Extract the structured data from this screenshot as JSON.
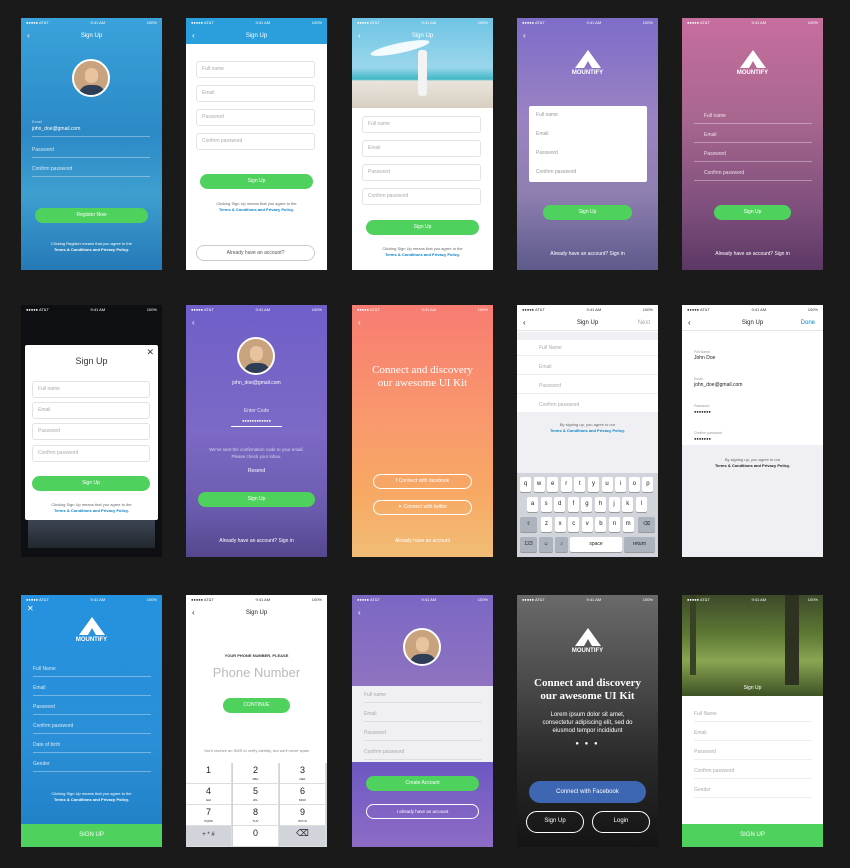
{
  "status": {
    "carrier": "●●●●● AT&T",
    "time": "9:41 AM",
    "battery": "100%"
  },
  "colors": {
    "blue": "#2b9fdc",
    "green": "#4fd15d",
    "purple": "#6f5fc9",
    "pink": "#c76e9e",
    "orange": "#f78b6d"
  },
  "s1": {
    "title": "Sign Up",
    "email_label": "Email",
    "email": "john_doe@gmail.com",
    "password": "Password",
    "confirm": "Confirm password",
    "button": "Register Now",
    "terms1": "Clicking Register means that you agree to the",
    "terms2": "Terms & Conditions and Privacy Policy."
  },
  "s2": {
    "title": "Sign Up",
    "fields": [
      "Full name",
      "Email",
      "Password",
      "Confirm password"
    ],
    "button": "Sign Up",
    "terms1": "Clicking Sign Up means that you agree to the",
    "terms2": "Terms & Conditions and Privacy Policy.",
    "have_account": "Already have an account?"
  },
  "s3": {
    "title": "Sign Up",
    "fields": [
      "Full name",
      "Email",
      "Password",
      "Confirm password"
    ],
    "button": "Sign Up",
    "terms1": "Clicking Sign Up means that you agree to the",
    "terms2": "Terms & Conditions and Privacy Policy."
  },
  "s4": {
    "brand": "MOUNTIFY",
    "fields": [
      "Full name",
      "Email",
      "Password",
      "Confirm password"
    ],
    "button": "Sign Up",
    "have_account": "Already have an account? Sign in"
  },
  "s5": {
    "brand": "MOUNTIFY",
    "fields": [
      "Full name",
      "Email",
      "Password",
      "Confirm password"
    ],
    "button": "Sign Up",
    "have_account": "Already have an account? Sign in"
  },
  "s6": {
    "title": "Sign Up",
    "close": "✕",
    "fields": [
      "Full name",
      "Email",
      "Password",
      "Confirm password"
    ],
    "button": "Sign Up",
    "terms1": "Clicking Sign Up means that you agree to the",
    "terms2": "Terms & Conditions and Privacy Policy."
  },
  "s7": {
    "email": "john_doe@gmail.com",
    "code_label": "Enter Code",
    "code": "●●●●●●●●●●●●",
    "info1": "We've sent the confirmation code to your email.",
    "info2": "Please check your inbox.",
    "resend": "Resend",
    "button": "Sign Up",
    "have_account": "Already have an account? Sign in"
  },
  "s8": {
    "headline1": "Connect and discovery",
    "headline2": "our awesome UI Kit",
    "facebook": "Connect with facebook",
    "twitter": "Connect with twitter",
    "have_account": "Already have an account"
  },
  "s9": {
    "title": "Sign Up",
    "next": "Next",
    "fields": [
      "Full Name",
      "Email",
      "Password",
      "Confirm password"
    ],
    "terms1": "By signing up, you agree to our",
    "terms2": "Terms & Conditions and Privacy Policy.",
    "row1": [
      "q",
      "w",
      "e",
      "r",
      "t",
      "y",
      "u",
      "i",
      "o",
      "p"
    ],
    "row2": [
      "a",
      "s",
      "d",
      "f",
      "g",
      "h",
      "j",
      "k",
      "l"
    ],
    "row3": [
      "z",
      "x",
      "c",
      "v",
      "b",
      "n",
      "m"
    ],
    "k123": "123",
    "space": "space",
    "return": "return"
  },
  "s10": {
    "title": "Sign Up",
    "done": "Done",
    "name_label": "Full Name",
    "name": "John Doe",
    "email_label": "Email",
    "email": "john_doe@gmail.com",
    "pass_label": "Password",
    "pass": "●●●●●●●",
    "confirm_label": "Confirm password",
    "confirm": "●●●●●●●",
    "terms1": "By signing up, you agree to our",
    "terms2": "Terms & Conditions and Privacy Policy."
  },
  "s11": {
    "close": "✕",
    "brand": "MOUNTIFY",
    "fields": [
      "Full Name",
      "Email",
      "Password",
      "Confirm password",
      "Date of birth",
      "Gender"
    ],
    "terms1": "Clicking Sign Up means that you agree to the",
    "terms2": "Terms & Conditions and Privacy Policy.",
    "button": "SIGN UP"
  },
  "s12": {
    "title": "Sign Up",
    "label": "YOUR PHONE NUMBER, PLEASE",
    "placeholder": "Phone Number",
    "button": "CONTINUE",
    "info": "You'll receive an SMS to verify identity, but we'll never spam",
    "keys": [
      [
        "1",
        ""
      ],
      [
        "2",
        "ABC"
      ],
      [
        "3",
        "DEF"
      ],
      [
        "4",
        "GHI"
      ],
      [
        "5",
        "JKL"
      ],
      [
        "6",
        "MNO"
      ],
      [
        "7",
        "PQRS"
      ],
      [
        "8",
        "TUV"
      ],
      [
        "9",
        "WXYZ"
      ],
      [
        "+ * #",
        ""
      ],
      [
        "0",
        ""
      ],
      [
        "⌫",
        ""
      ]
    ]
  },
  "s13": {
    "fields": [
      "Full name",
      "Email",
      "Password",
      "Confirm password"
    ],
    "create": "Create Account",
    "have_account": "I already have an account"
  },
  "s14": {
    "brand": "MOUNTIFY",
    "headline1": "Connect and discovery",
    "headline2": "our awesome UI Kit",
    "body1": "Lorem ipsum dolor sit amet,",
    "body2": "consectetur adipiscing elit, sed do",
    "body3": "eiusmod tempor incididunt",
    "facebook": "Connect with Facebook",
    "signup": "Sign Up",
    "login": "Login"
  },
  "s15": {
    "title": "Sign Up",
    "fields": [
      "Full Name",
      "Email",
      "Password",
      "Confirm password",
      "Gender"
    ],
    "button": "SIGN UP"
  }
}
